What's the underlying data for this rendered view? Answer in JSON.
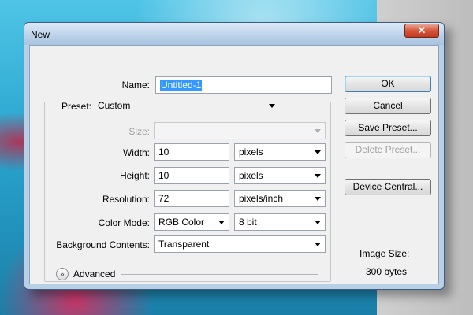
{
  "window": {
    "title": "New",
    "close_label": "✕"
  },
  "form": {
    "name": {
      "label": "Name:",
      "value": "Untitled-1"
    },
    "preset": {
      "label": "Preset:",
      "value": "Custom"
    },
    "size": {
      "label": "Size:",
      "value": ""
    },
    "width": {
      "label": "Width:",
      "value": "10",
      "unit": "pixels"
    },
    "height": {
      "label": "Height:",
      "value": "10",
      "unit": "pixels"
    },
    "resolution": {
      "label": "Resolution:",
      "value": "72",
      "unit": "pixels/inch"
    },
    "color_mode": {
      "label": "Color Mode:",
      "value": "RGB Color",
      "depth": "8 bit"
    },
    "background": {
      "label": "Background Contents:",
      "value": "Transparent"
    },
    "advanced": {
      "label": "Advanced"
    }
  },
  "buttons": {
    "ok": "OK",
    "cancel": "Cancel",
    "save_preset": "Save Preset...",
    "delete_preset": "Delete Preset...",
    "device_central": "Device Central..."
  },
  "image_size": {
    "label": "Image Size:",
    "value": "300 bytes"
  },
  "icons": {
    "close": "close-icon",
    "dropdown": "chevron-down-icon",
    "advanced": "double-chevron-down-icon"
  },
  "colors": {
    "selection": "#3399ff",
    "title_bar": "#bed3ea",
    "close_button": "#d7553b",
    "default_button_border": "#3c7fb1"
  }
}
